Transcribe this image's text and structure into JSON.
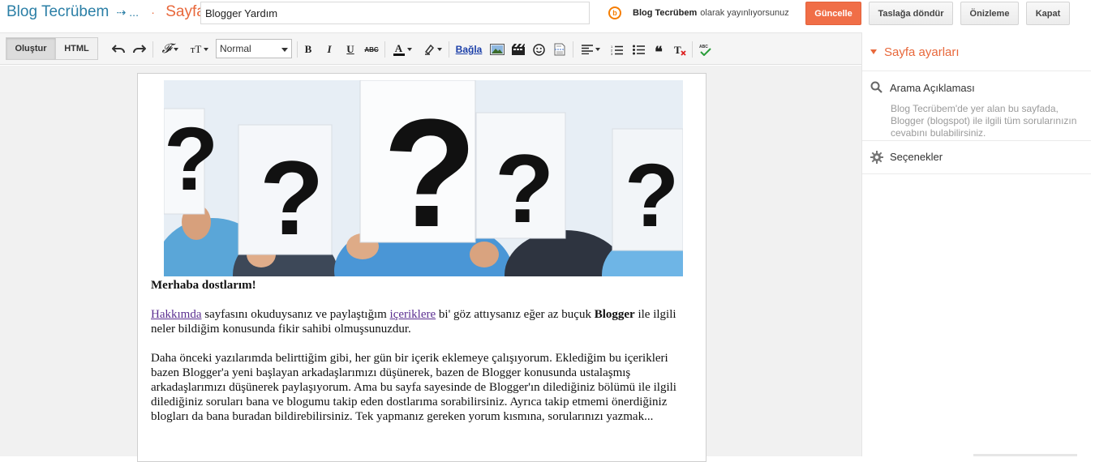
{
  "header": {
    "blog_name": "Blog Tecrübem",
    "arrow": "⇢ ...",
    "dot": "·",
    "page_type": "Sayfa",
    "page_title_value": "Blogger Yardım",
    "publishing_blog": "Blog Tecrübem",
    "publishing_suffix": "olarak yayınlıyorsunuz",
    "buttons": {
      "update": "Güncelle",
      "revert": "Taslağa döndür",
      "preview": "Önizleme",
      "close": "Kapat"
    }
  },
  "toolbar": {
    "compose": "Oluştur",
    "html": "HTML",
    "format": "Normal",
    "link": "Bağla"
  },
  "document": {
    "greeting": "Merhaba dostlarım!",
    "p1_link1": "Hakkımda",
    "p1_text1": " sayfasını okuduysanız ve paylaştığım ",
    "p1_link2": "içeriklere",
    "p1_text2": " bi' göz attıysanız eğer az buçuk ",
    "p1_bold": "Blogger",
    "p1_text3": " ile ilgili neler bildiğim konusunda fikir sahibi olmuşsunuzdur.",
    "p2": "Daha önceki yazılarımda belirttiğim gibi, her gün bir içerik eklemeye çalışıyorum. Eklediğim bu içerikleri bazen Blogger'a yeni başlayan arkadaşlarımızı düşünerek, bazen de Blogger konusunda ustalaşmış arkadaşlarımızı düşünerek paylaşıyorum. Ama bu sayfa sayesinde de Blogger'ın dilediğiniz bölümü ile ilgili dilediğiniz soruları bana ve blogumu takip eden dostlarıma sorabilirsiniz. Ayrıca takip etmemi önerdiğiniz blogları da bana buradan bildirebilirsiniz. Tek yapmanız gereken yorum kısmına, sorularınızı yazmak..."
  },
  "sidebar": {
    "title": "Sayfa ayarları",
    "search_desc_label": "Arama Açıklaması",
    "search_desc_text": "Blog Tecrübem'de yer alan bu sayfada, Blogger (blogspot) ile ilgili tüm sorularınızın cevabını bulabilirsiniz.",
    "options_label": "Seçenekler"
  },
  "colors": {
    "accent_orange": "#e8683b",
    "blog_blue": "#2b7fa6",
    "update_button": "#f06e47",
    "link_purple": "#5b2f91"
  }
}
